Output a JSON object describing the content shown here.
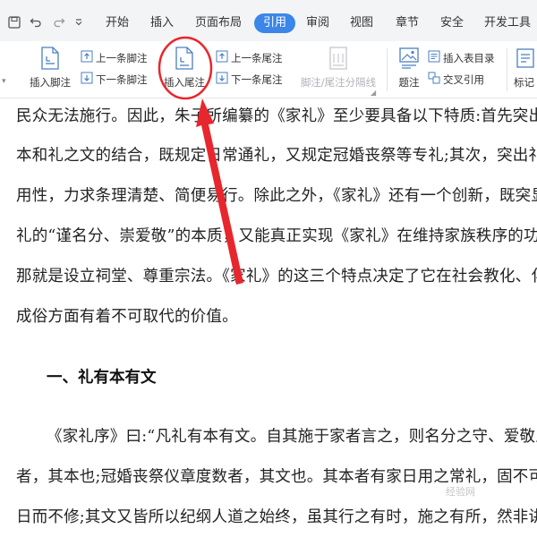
{
  "menubar": {
    "quick_icons": [
      "save-icon",
      "undo-icon",
      "redo-icon",
      "more-dropdown-icon"
    ],
    "tabs": [
      "开始",
      "插入",
      "页面布局",
      "引用",
      "审阅",
      "视图",
      "章节",
      "安全",
      "开发工具"
    ],
    "active_tab": "引用",
    "accent_color": "#3b86e8"
  },
  "ribbon": {
    "insert_footnote": "插入脚注",
    "prev_footnote": "上一条脚注",
    "next_footnote": "下一条脚注",
    "insert_endnote": "插入尾注",
    "prev_endnote": "上一条尾注",
    "next_endnote": "下一条尾注",
    "footnote_separator": "脚注/尾注分隔线",
    "caption": "题注",
    "insert_table_of_figures": "插入表目录",
    "cross_reference": "交叉引用",
    "mark_partial": "标记"
  },
  "document": {
    "lines": [
      "民众无法施行。因此，朱子所编纂的《家礼》至少要具备以下特质:首先突出礼",
      "本和礼之文的结合，既规定日常通礼，又规定冠婚丧祭等专礼;其次，突出礼的",
      "用性，力求条理清楚、简便易行。除此之外，《家礼》还有一个创新，既突显",
      "礼的“谨名分、崇爱敬”的本质，又能真正实现《家礼》在维持家族秩序的功",
      "那就是设立祠堂、尊重宗法。《家礼》的这三个特点决定了它在社会教化、化",
      "成俗方面有着不可取代的价值。"
    ],
    "heading": "一、礼有本有文",
    "lines2": [
      "《家礼序》曰:“凡礼有本有文。自其施于家者言之，则名分之守、爱敬之",
      "者，其本也;冠婚丧祭仪章度数者，其文也。其本者有家日用之常礼，固不可以",
      "日而不修;其文又皆所以纪纲人道之始终，虽其行之有时，施之有所，然非讲之"
    ]
  },
  "annotation": {
    "circle_color": "#e8262d",
    "arrow_color": "#e8262d",
    "watermark": "经验网"
  }
}
